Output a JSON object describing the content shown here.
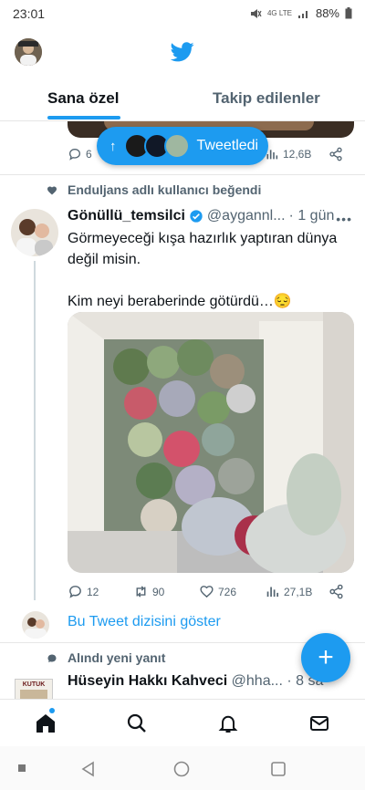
{
  "status": {
    "time": "23:01",
    "network": "4G LTE",
    "battery": "88%"
  },
  "header": {
    "logo": "twitter-bird-icon"
  },
  "tabs": [
    {
      "label": "Sana özel",
      "active": true
    },
    {
      "label": "Takip edilenler",
      "active": false
    }
  ],
  "prev_tweet": {
    "replies": "6",
    "views": "12,6B"
  },
  "new_tweets_pill": {
    "label": "Tweetledi"
  },
  "tweet": {
    "social_context": "Enduljans adlı kullanıcı beğendi",
    "author_name": "Gönüllü_temsilci",
    "handle": "@aygannl...",
    "time": "· 1 gün",
    "text_1": "Görmeyeceği kışa hazırlık yaptıran dünya değil misin.",
    "text_2": "Kim neyi beraberinde götürdü…😔",
    "replies": "12",
    "retweets": "90",
    "likes": "726",
    "views": "27,1B",
    "show_thread": "Bu Tweet dizisini göster"
  },
  "next_tweet": {
    "social_context": "Alındı yeni yanıt",
    "author_name": "Hüseyin Hakkı Kahveci",
    "handle": "@hha...",
    "time": "· 8 sa",
    "avatar_label": "KUTUK"
  },
  "colors": {
    "accent": "#1d9bf0",
    "text": "#0f1419",
    "secondary": "#536471"
  }
}
